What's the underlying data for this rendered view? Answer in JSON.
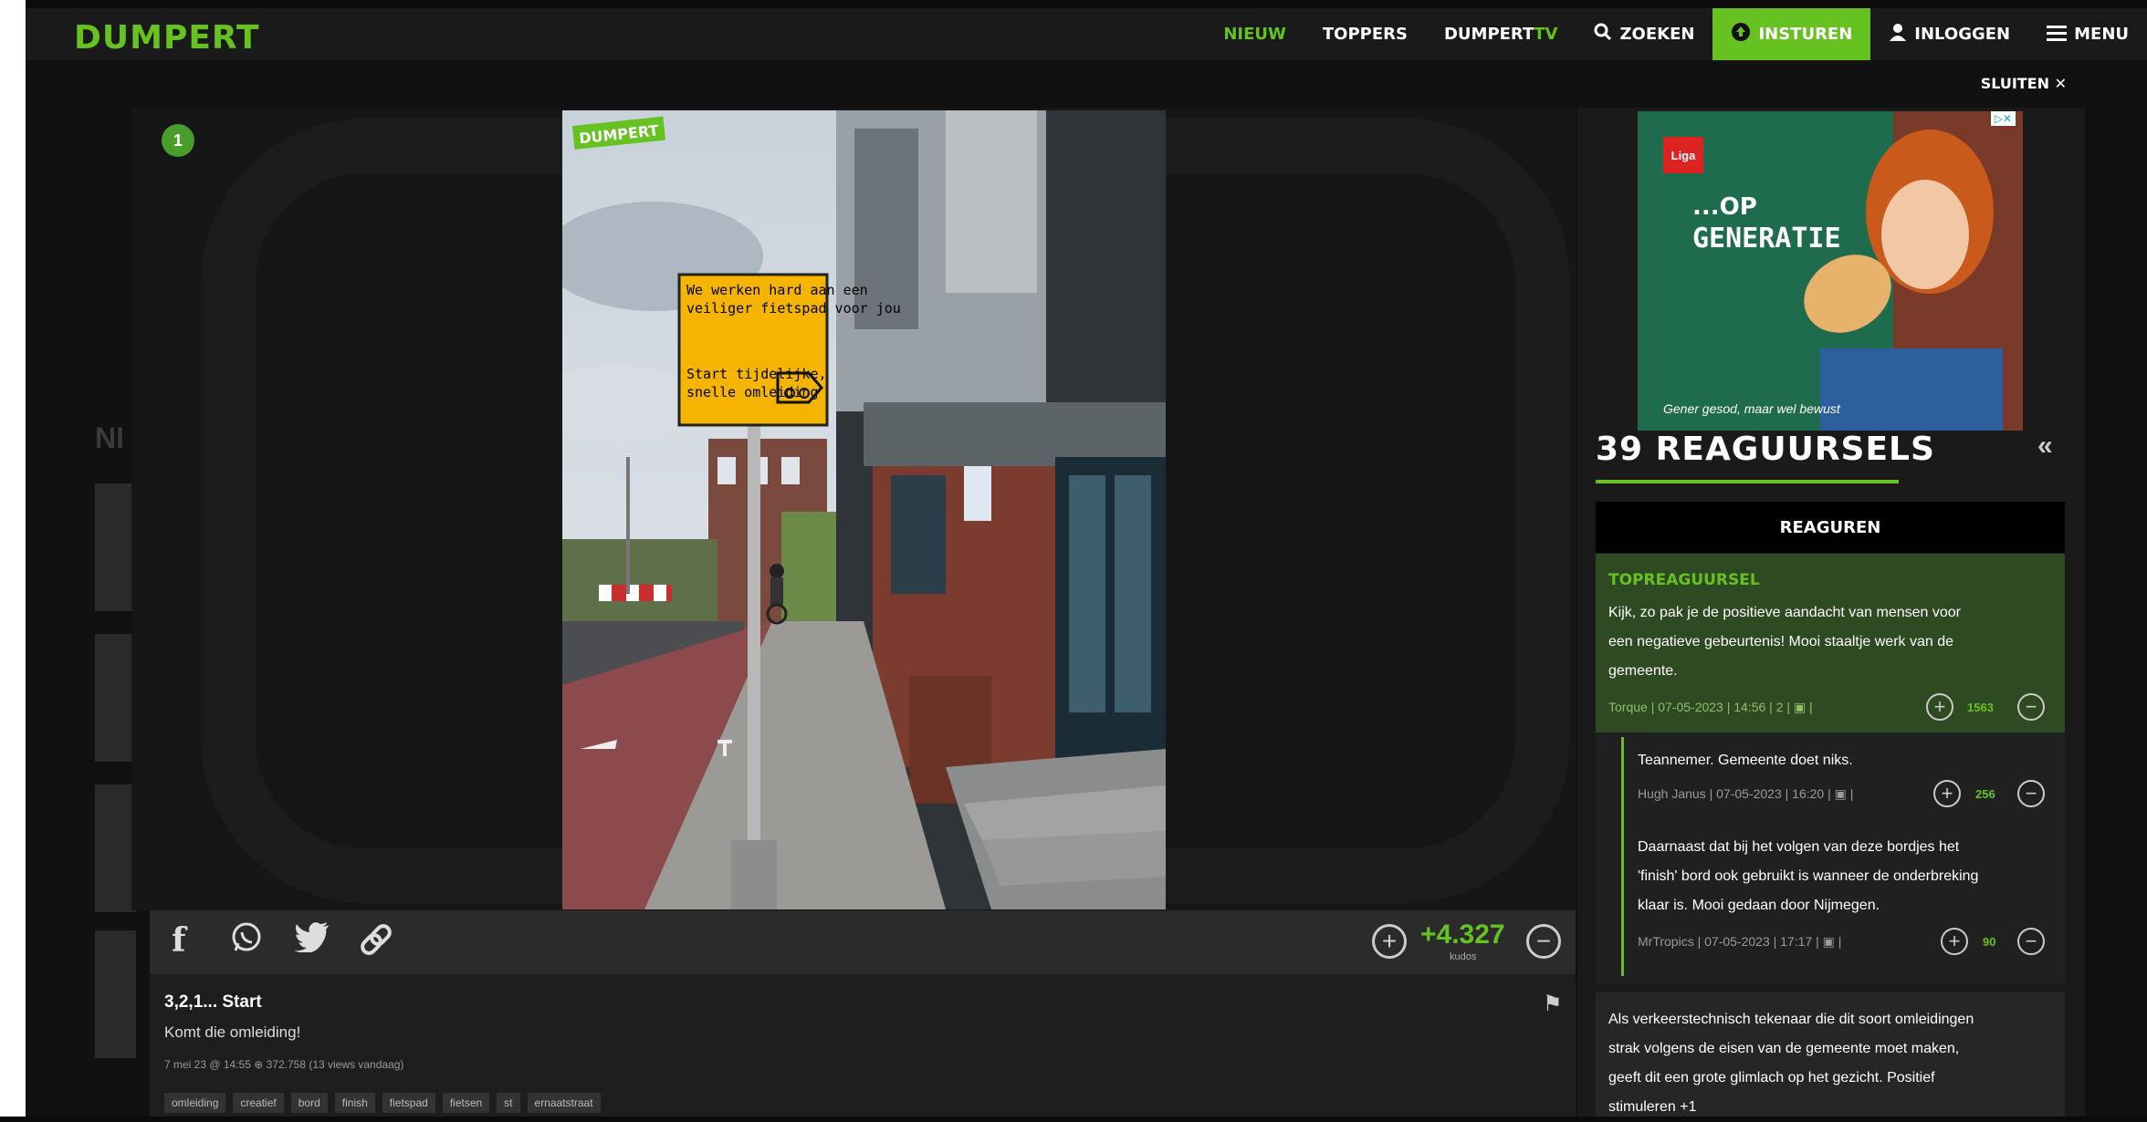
{
  "header": {
    "logo": "DUMPERT",
    "nav": {
      "nieuw": "NIEUW",
      "toppers": "TOPPERS",
      "dumpert_tv_a": "DUMPERT",
      "dumpert_tv_b": "TV",
      "zoeken": "ZOEKEN",
      "insturen": "INSTUREN",
      "inloggen": "INLOGGEN",
      "menu": "MENU"
    },
    "close_label": "SLUITEN ✕"
  },
  "player": {
    "badge": "1",
    "watermark": "DUMPERT",
    "sign_line1": "We werken hard aan een",
    "sign_line2": "veiliger fietspad voor jou",
    "sign_line3": "Start tijdelijke,",
    "sign_line4": "snelle omleiding"
  },
  "share": {
    "kudos_value": "+4.327",
    "kudos_label": "kudos"
  },
  "video_info": {
    "title": "3,2,1... Start",
    "description": "Komt die omleiding!",
    "meta": "7 mei 23 @ 14:55 ⊕ 372.758 (13 views vandaag)",
    "tags": [
      "omleiding",
      "creatief",
      "bord",
      "finish",
      "fietspad",
      "fietsen",
      "st",
      "ernaatstraat"
    ]
  },
  "ad": {
    "brand": "Liga",
    "line1": "...OP",
    "line2": "GENERATIE",
    "footer": "Gener gesod, maar wel bewust",
    "info": "▷✕"
  },
  "ghost": {
    "section_title": "NI"
  },
  "comments": {
    "heading": "39 REAGUURSELS",
    "react_button": "REAGUREN",
    "top_label": "TOPREAGUURSEL",
    "top": {
      "line1": "Kijk, zo pak je de positieve aandacht van mensen voor",
      "line2": "een negatieve gebeurtenis! Mooi staaltje werk van de",
      "line3": "gemeente.",
      "meta": "Torque | 07-05-2023 | 14:56 | 2 | ▣ |",
      "score": "1563"
    },
    "reply1": {
      "text": "Teannemer. Gemeente doet niks.",
      "meta": "Hugh Janus | 07-05-2023 | 16:20 | ▣ |",
      "score": "256"
    },
    "reply2": {
      "line1": "Daarnaast dat bij het volgen van deze bordjes het",
      "line2": "'finish' bord ook gebruikt is wanneer de onderbreking",
      "line3": "klaar is. Mooi gedaan door Nijmegen.",
      "meta": "MrTropics | 07-05-2023 | 17:17 | ▣ |",
      "score": "90"
    },
    "third": {
      "line1": "Als verkeerstechnisch tekenaar die dit soort omleidingen",
      "line2": "strak volgens de eisen van de gemeente moet maken,",
      "line3": "geeft dit een grote glimlach op het gezicht. Positief",
      "line4": "stimuleren +1"
    }
  }
}
